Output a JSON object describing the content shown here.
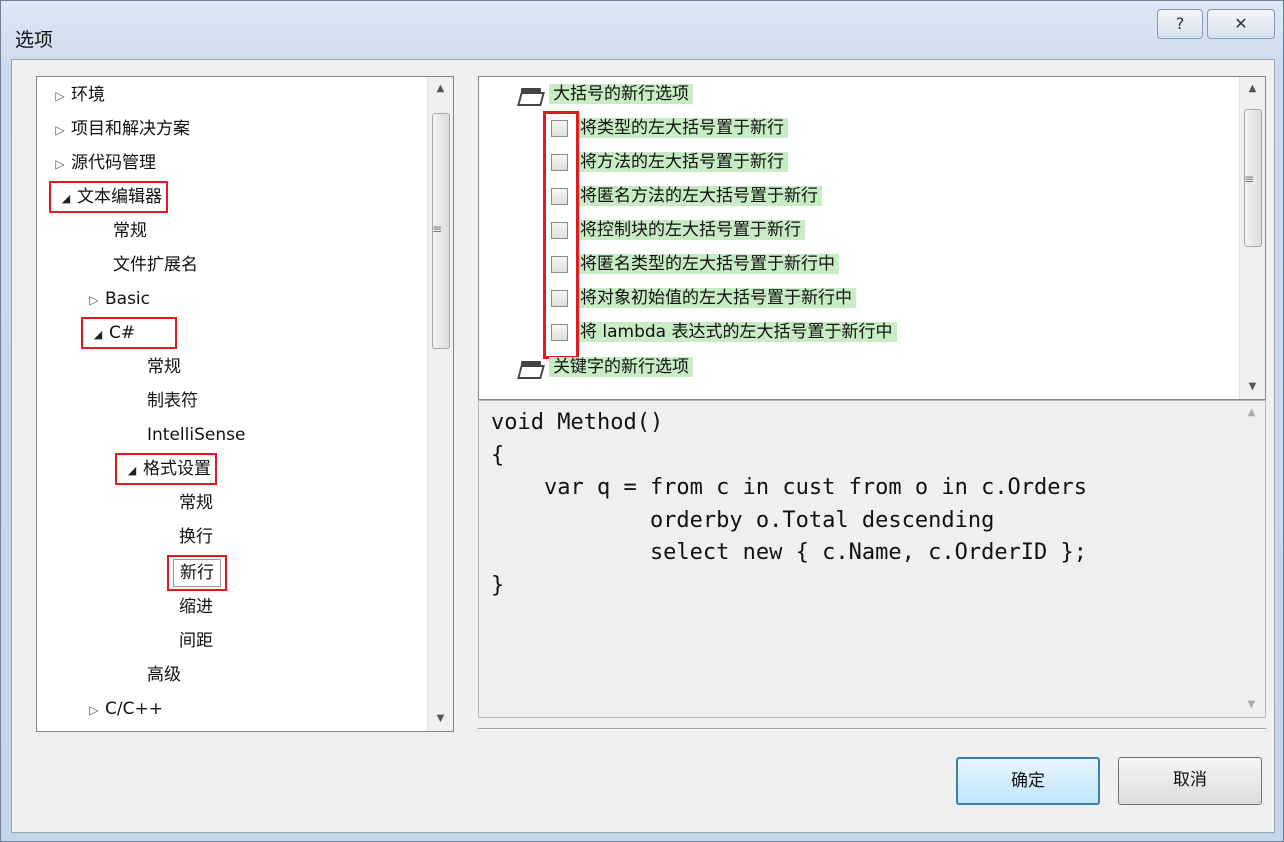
{
  "window": {
    "title": "选项",
    "help_glyph": "?",
    "close_glyph": "✕"
  },
  "tree": [
    {
      "label": "环境",
      "arrow": "▷"
    },
    {
      "label": "项目和解决方案",
      "arrow": "▷"
    },
    {
      "label": "源代码管理",
      "arrow": "▷"
    },
    {
      "label": "文本编辑器",
      "arrow": "◢"
    },
    {
      "label": "常规"
    },
    {
      "label": "文件扩展名"
    },
    {
      "label": "Basic",
      "arrow": "▷"
    },
    {
      "label": "C#",
      "arrow": "◢"
    },
    {
      "label": "常规"
    },
    {
      "label": "制表符"
    },
    {
      "label": "IntelliSense"
    },
    {
      "label": "格式设置",
      "arrow": "◢"
    },
    {
      "label": "常规"
    },
    {
      "label": "换行"
    },
    {
      "label": "新行"
    },
    {
      "label": "缩进"
    },
    {
      "label": "间距"
    },
    {
      "label": "高级"
    },
    {
      "label": "C/C++",
      "arrow": "▷"
    }
  ],
  "options": {
    "category1": "大括号的新行选项",
    "items": [
      "将类型的左大括号置于新行",
      "将方法的左大括号置于新行",
      "将匿名方法的左大括号置于新行",
      "将控制块的左大括号置于新行",
      "将匿名类型的左大括号置于新行中",
      "将对象初始值的左大括号置于新行中",
      "将 lambda 表达式的左大括号置于新行中"
    ],
    "category2": "关键字的新行选项"
  },
  "preview": {
    "lines": [
      "void Method()",
      "{",
      "    var q = from c in cust from o in c.Orders",
      "            orderby o.Total descending",
      "            select new { c.Name, c.OrderID };",
      "}"
    ]
  },
  "buttons": {
    "ok": "确定",
    "cancel": "取消"
  },
  "scroll": {
    "up": "▲",
    "down": "▼",
    "grip": "≡"
  }
}
